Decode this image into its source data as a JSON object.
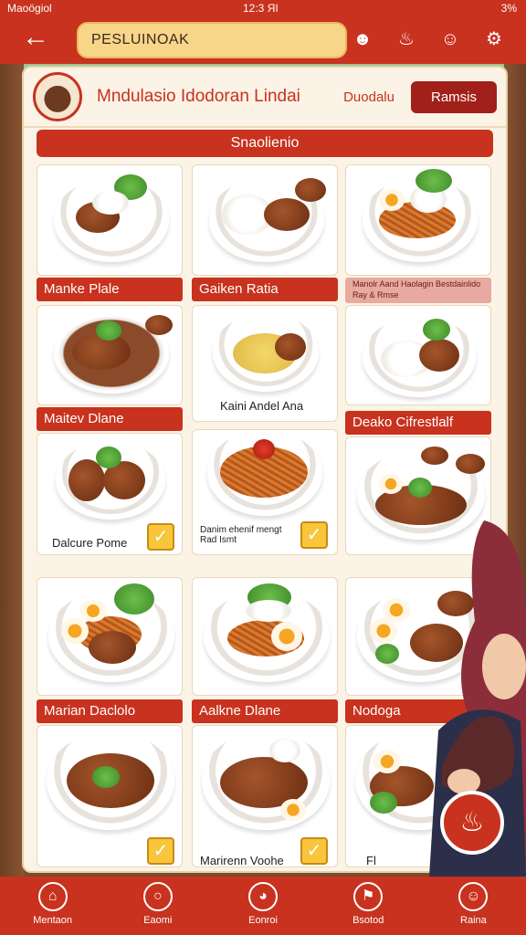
{
  "status_bar": {
    "carrier": "Maoögiol",
    "time": "12:3 ЯІ",
    "battery": "3%"
  },
  "top_nav": {
    "search_value": "PESLUINOAK",
    "icons": [
      "chef-icon",
      "dish-icon",
      "robot-icon",
      "settings-icon"
    ]
  },
  "panel": {
    "title": "Mndulasio Idodoran Lindai",
    "tab_inactive": "Duodalu",
    "tab_active": "Ramsis",
    "section": "Snaolienio"
  },
  "labels": {
    "row2_a": "Manke Plale",
    "row2_b": "Gaiken Ratia",
    "row2_c": "Manolr Aand Haolagin Bestdainlido Ray & Rmse",
    "row3_a": "Maitev Dlane",
    "row3_c": "Deako Cifrestlalf",
    "row5_a": "Marian Daclolo",
    "row5_b": "Aalkne Dlane",
    "row5_c": "Nodoga"
  },
  "captions": {
    "mid_b": "Kaini Andel Ana",
    "card_a4": "Dalcure Pome",
    "card_b4": "Danim ehenif mengt Rad Ismt",
    "card_b6": "Marirenn Voohe",
    "card_c6": "Fl"
  },
  "bottom_nav": [
    {
      "label": "Mentaon",
      "icon": "home-icon"
    },
    {
      "label": "Eaomi",
      "icon": "plate-icon"
    },
    {
      "label": "Eonroi",
      "icon": "bowl-icon"
    },
    {
      "label": "Bsotod",
      "icon": "bookmark-icon"
    },
    {
      "label": "Raina",
      "icon": "person-icon"
    }
  ],
  "colors": {
    "primary": "#c8321e",
    "search_bg": "#f7d68a",
    "panel_bg": "#fbf3e6"
  }
}
